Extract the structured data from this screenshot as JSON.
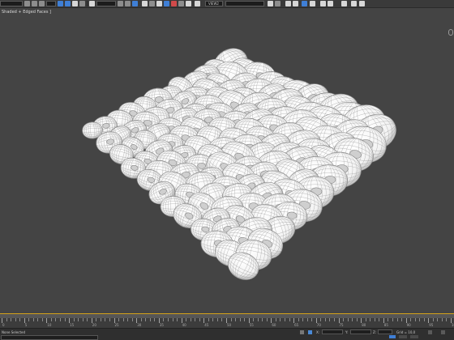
{
  "toolbar": {
    "view_dropdown_value": "VIEW2",
    "icons": [
      "undo-icon",
      "redo-icon",
      "link-icon",
      "unlink-icon",
      "bind-space-warp-icon",
      "selection-filter-icon",
      "select-object-icon",
      "select-by-name-icon",
      "select-region-icon",
      "window-crossing-icon",
      "select-move-icon",
      "select-rotate-icon",
      "select-scale-icon",
      "reference-coordinate-icon",
      "pivot-center-icon",
      "manipulate-icon",
      "keyboard-shortcut-icon",
      "snaps-toggle-icon",
      "angle-snap-icon",
      "percent-snap-icon",
      "spinner-snap-icon",
      "edit-named-selections-icon",
      "mirror-icon",
      "align-icon",
      "layer-explorer-icon",
      "curve-editor-icon",
      "schematic-view-icon",
      "material-editor-icon",
      "render-setup-icon",
      "rendered-frame-window-icon",
      "render-production-icon"
    ],
    "accent_color": "#3f7fd6"
  },
  "viewport": {
    "label": "Shaded + Edged Faces ]",
    "background": "#444444",
    "mesh_color": "#f2f2f2",
    "wire_color": "#8a8a8a"
  },
  "timeline": {
    "ruler_labels": [
      "0",
      "5",
      "10",
      "15",
      "20",
      "25",
      "30",
      "35",
      "40",
      "45",
      "50",
      "55",
      "60",
      "65",
      "70",
      "75",
      "80",
      "85",
      "90",
      "95",
      "100"
    ],
    "slider_accent": "#d4a21a"
  },
  "statusbar": {
    "status_text": "None Selected",
    "grid_text": "Grid = 10,0",
    "x_label": "X:",
    "y_label": "Y:",
    "z_label": "Z:"
  }
}
